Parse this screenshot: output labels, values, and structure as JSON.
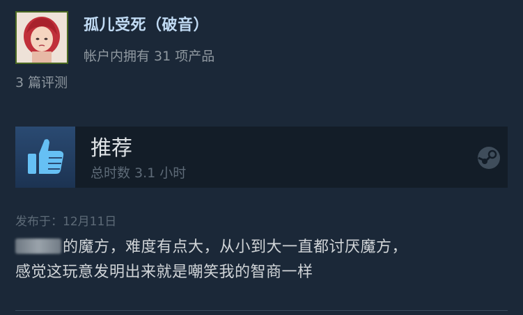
{
  "user": {
    "name": "孤儿受死（破音）",
    "owned_products": "帐户内拥有 31 项产品",
    "review_count": "3 篇评测"
  },
  "vote": {
    "label": "推荐",
    "hours": "总时数 3.1 小时"
  },
  "review": {
    "posted": "发布于：12月11日",
    "line1": "的魔方，难度有点大，从小到大一直都讨厌魔方，",
    "line2": "感觉这玩意发明出来就是嘲笑我的智商一样"
  },
  "icons": {
    "vote_icon": "thumbs-up-icon",
    "platform_icon": "steam-logo-icon"
  },
  "colors": {
    "background": "#1b2838",
    "username": "#c1dbf4",
    "thumb_blue": "#66c0f4"
  }
}
